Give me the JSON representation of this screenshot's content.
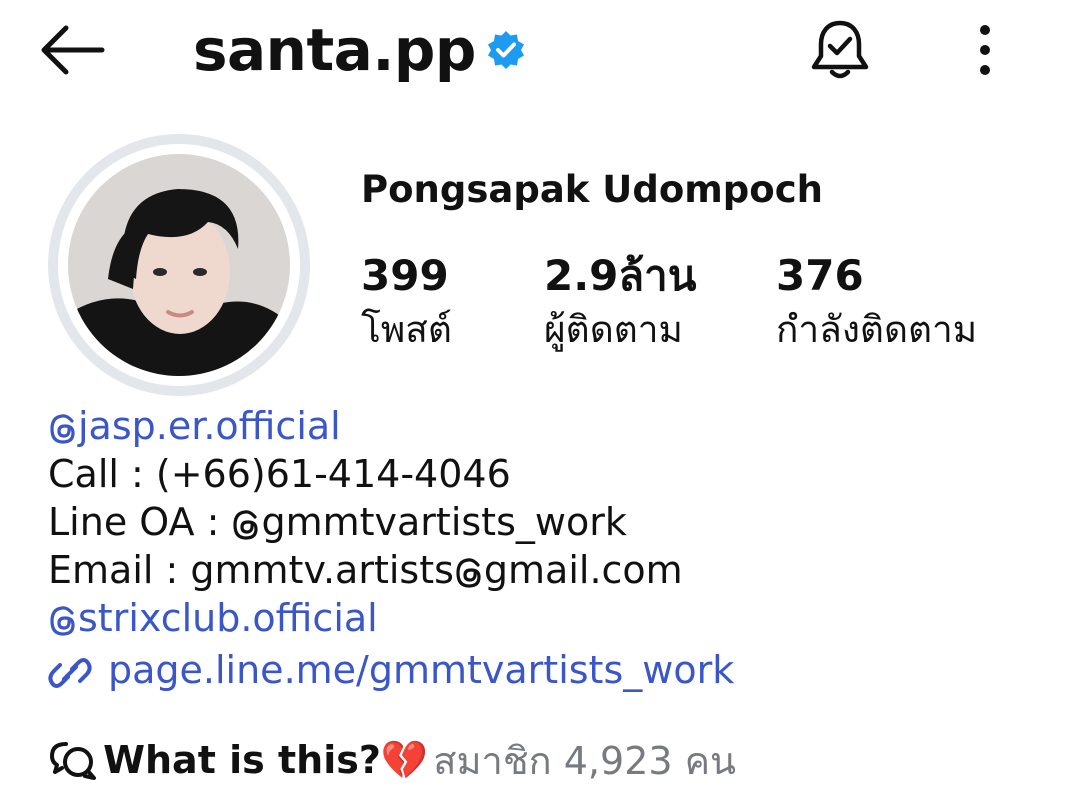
{
  "header": {
    "username": "santa.pp",
    "icons": {
      "back": "back-arrow-icon",
      "verified": "verified-badge-icon",
      "bell": "notification-bell-icon",
      "more": "more-options-icon"
    }
  },
  "profile": {
    "full_name": "Pongsapak Udompoch",
    "stats": [
      {
        "value": "399",
        "label": "โพสต์"
      },
      {
        "value": "2.9ล้าน",
        "label": "ผู้ติดตาม"
      },
      {
        "value": "376",
        "label": "กำลังติดตาม"
      }
    ]
  },
  "bio": {
    "threads_handle": "jasp.er.official",
    "call": "Call : (+66)61-414-4046",
    "line_prefix": "Line OA : ",
    "line_handle": "gmmtvartists_work",
    "email_prefix": "Email : gmmtv.artists",
    "email_suffix": "gmail.com",
    "threads_handle_2": "strixclub.official",
    "website": "page.line.me/gmmtvartists_work"
  },
  "channel": {
    "title": "What is this?💔",
    "members": "สมาชิก 4,923 คน"
  },
  "colors": {
    "link": "#3a56c8",
    "verified": "#1d9bf0",
    "muted": "#777a80"
  }
}
